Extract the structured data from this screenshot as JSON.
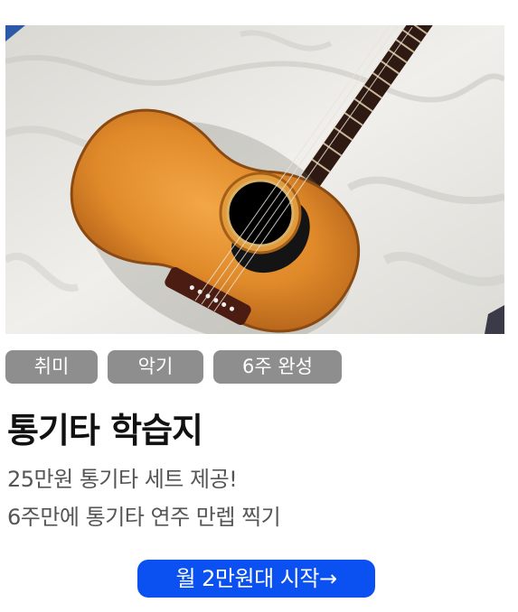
{
  "card": {
    "tags": [
      "취미",
      "악기",
      "6주 완성"
    ],
    "title": "통기타 학습지",
    "description": [
      "25만원 통기타 세트 제공!",
      "6주만에 통기타 연주 만렙 찍기"
    ],
    "cta_label": "월 2만원대 시작→"
  },
  "colors": {
    "tag_bg": "#8e8e8e",
    "cta_bg": "#0b50f0",
    "title": "#111111",
    "description": "#555555"
  }
}
